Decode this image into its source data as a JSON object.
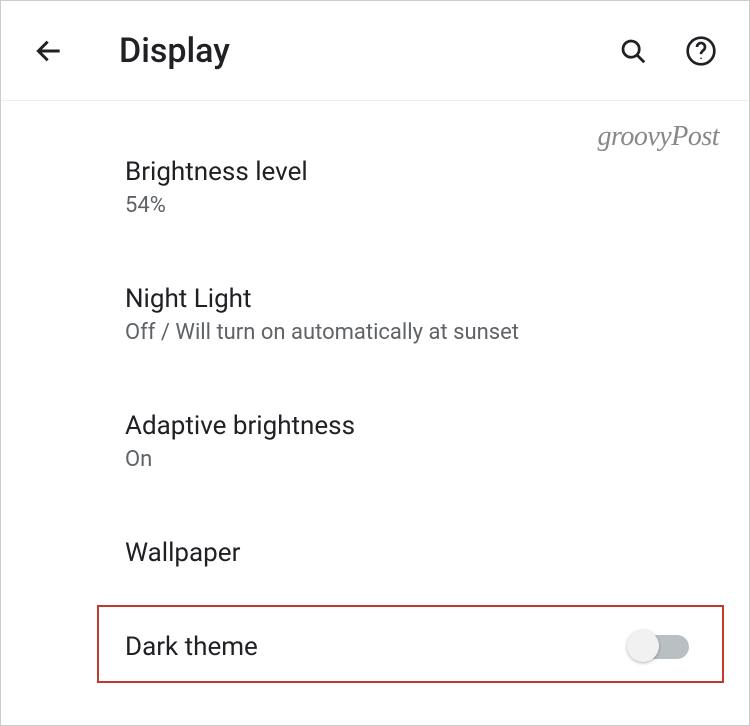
{
  "header": {
    "title": "Display"
  },
  "watermark": "groovyPost",
  "settings": {
    "brightness": {
      "title": "Brightness level",
      "sub": "54%"
    },
    "nightlight": {
      "title": "Night Light",
      "sub": "Off / Will turn on automatically at sunset"
    },
    "adaptive": {
      "title": "Adaptive brightness",
      "sub": "On"
    },
    "wallpaper": {
      "title": "Wallpaper"
    },
    "darktheme": {
      "title": "Dark theme",
      "toggle": false
    }
  }
}
